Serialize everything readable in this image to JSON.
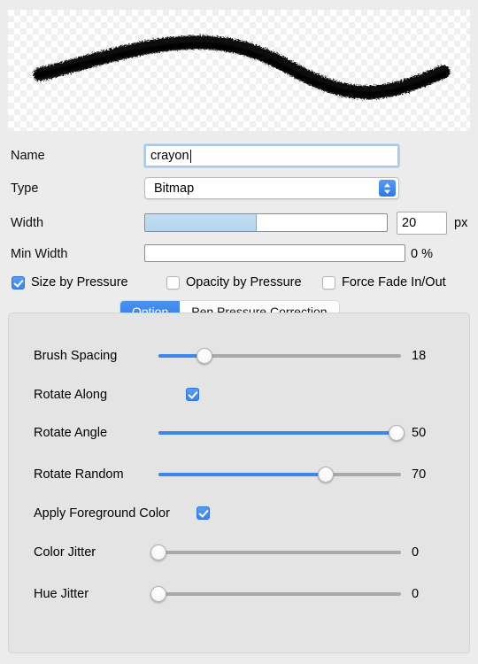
{
  "preview": {
    "name": "brush-stroke-preview",
    "background": "transparency-checkerboard",
    "stroke_color": "#111111",
    "description": "crayon brush sample stroke"
  },
  "form": {
    "name": {
      "label": "Name",
      "value": "crayon",
      "placeholder": "Name"
    },
    "type": {
      "label": "Type",
      "value": "Bitmap",
      "options": [
        "Bitmap"
      ]
    },
    "width": {
      "label": "Width",
      "value": "20",
      "unit": "px",
      "fill_percent": 46
    },
    "min_width": {
      "label": "Min Width",
      "value": "0 %",
      "fill_percent": 0
    }
  },
  "pressure_checks": [
    {
      "label": "Size by Pressure",
      "checked": true
    },
    {
      "label": "Opacity by Pressure",
      "checked": false
    },
    {
      "label": "Force Fade In/Out",
      "checked": false
    }
  ],
  "tabs": [
    {
      "label": "Option",
      "active": true
    },
    {
      "label": "Pen Pressure Correction",
      "active": false
    }
  ],
  "options": [
    {
      "label": "Brush Spacing",
      "kind": "slider",
      "value": "18",
      "percent": 19
    },
    {
      "label": "Rotate Along",
      "kind": "checkbox",
      "checked": true
    },
    {
      "label": "Rotate Angle",
      "kind": "slider",
      "value": "50",
      "percent": 98
    },
    {
      "label": "Rotate Random",
      "kind": "slider",
      "value": "70",
      "percent": 69
    },
    {
      "label": "Apply Foreground Color",
      "kind": "checkbox-inline",
      "checked": true
    },
    {
      "label": "Color Jitter",
      "kind": "slider",
      "value": "0",
      "percent": 0
    },
    {
      "label": "Hue Jitter",
      "kind": "slider",
      "value": "0",
      "percent": 0
    }
  ],
  "colors": {
    "accent": "#3d86ea",
    "window_bg": "#ececec",
    "panel_bg": "#e4e4e4"
  }
}
